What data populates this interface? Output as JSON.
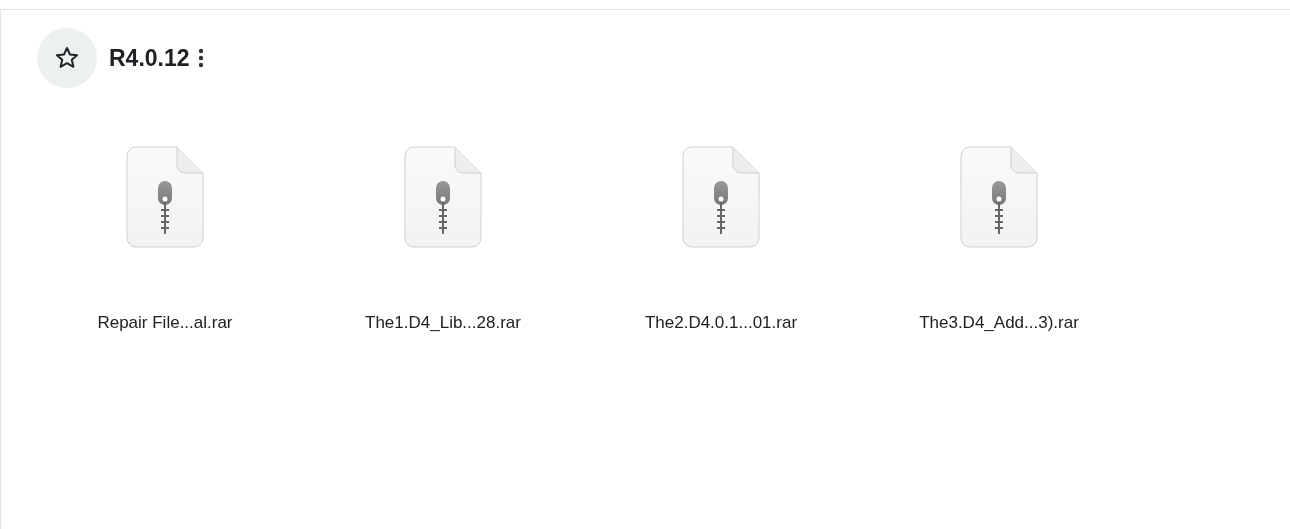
{
  "folder": {
    "title": "R4.0.12",
    "starred": false
  },
  "files": [
    {
      "name": "Repair File...al.rar"
    },
    {
      "name": "The1.D4_Lib...28.rar"
    },
    {
      "name": "The2.D4.0.1...01.rar"
    },
    {
      "name": "The3.D4_Add...3).rar"
    }
  ]
}
